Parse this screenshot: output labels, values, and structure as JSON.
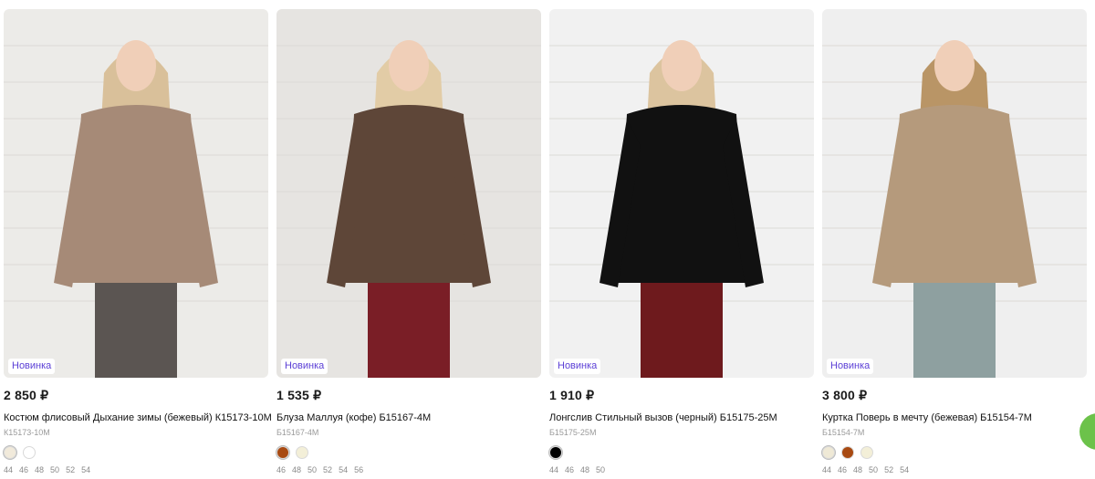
{
  "products": [
    {
      "badge": "Новинка",
      "price": "2 850 ₽",
      "name": "Костюм флисовый Дыхание зимы (бежевый) К15173-10М",
      "sku": "К15173-10М",
      "colors": [
        "#f1eadb",
        "#ffffff"
      ],
      "sizes": [
        "44",
        "46",
        "48",
        "50",
        "52",
        "54"
      ]
    },
    {
      "badge": "Новинка",
      "price": "1 535 ₽",
      "name": "Блуза Маллуя (кофе) Б15167-4М",
      "sku": "Б15167-4М",
      "colors": [
        "#a84a12",
        "#f3efd8"
      ],
      "sizes": [
        "46",
        "48",
        "50",
        "52",
        "54",
        "56"
      ]
    },
    {
      "badge": "Новинка",
      "price": "1 910 ₽",
      "name": "Лонгслив Стильный вызов (черный) Б15175-25М",
      "sku": "Б15175-25М",
      "colors": [
        "#000000"
      ],
      "sizes": [
        "44",
        "46",
        "48",
        "50"
      ]
    },
    {
      "badge": "Новинка",
      "price": "3 800 ₽",
      "name": "Куртка Поверь в мечту (бежевая) Б15154-7М",
      "sku": "Б15154-7М",
      "colors": [
        "#efe9d6",
        "#a84a12",
        "#f3efd8"
      ],
      "sizes": [
        "44",
        "46",
        "48",
        "50",
        "52",
        "54"
      ]
    }
  ],
  "photos": [
    {
      "bg": "#ecebe8",
      "garment": "#a68a77",
      "pants": "#5b5552",
      "hair": "#d9c09a"
    },
    {
      "bg": "#e6e4e1",
      "garment": "#5e4638",
      "pants": "#7a1e26",
      "hair": "#e2cca6"
    },
    {
      "bg": "#f1f1f1",
      "garment": "#111111",
      "pants": "#6e1a1d",
      "hair": "#dcc49f"
    },
    {
      "bg": "#efefef",
      "garment": "#b59a7c",
      "pants": "#8ea0a0",
      "hair": "#b99566"
    }
  ],
  "accent": "#5b3fd6",
  "chat_color": "#6cc24a"
}
